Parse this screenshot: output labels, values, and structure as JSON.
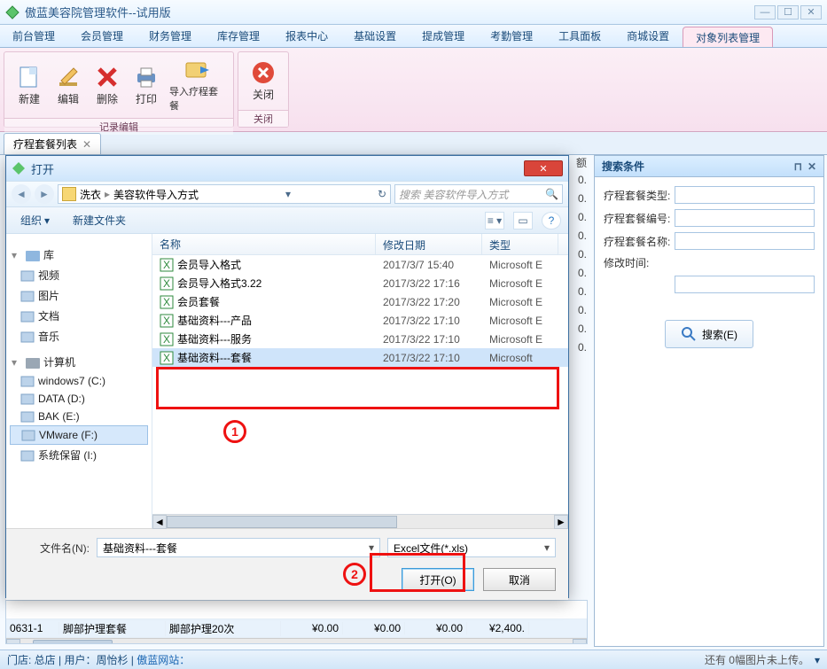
{
  "app": {
    "title": "傲蓝美容院管理软件--试用版"
  },
  "menu": {
    "items": [
      "前台管理",
      "会员管理",
      "财务管理",
      "库存管理",
      "报表中心",
      "基础设置",
      "提成管理",
      "考勤管理",
      "工具面板",
      "商城设置",
      "对象列表管理"
    ],
    "active_index": 10
  },
  "ribbon": {
    "group1_label": "记录编辑",
    "btn_new": "新建",
    "btn_edit": "编辑",
    "btn_delete": "删除",
    "btn_print": "打印",
    "btn_import": "导入疗程套餐",
    "group2_label": "关闭",
    "btn_close": "关闭"
  },
  "doc_tab": {
    "label": "疗程套餐列表"
  },
  "search_panel": {
    "title": "搜索条件",
    "field_type": "疗程套餐类型:",
    "field_code": "疗程套餐编号:",
    "field_name": "疗程套餐名称:",
    "field_modtime": "修改时间:",
    "button": "搜索(E)"
  },
  "grid": {
    "rows": [
      {
        "c0": "0631-1",
        "c1": "脚部护理套餐",
        "c2": "脚部护理20次",
        "c3": "¥0.00",
        "c4": "¥0.00",
        "c5": "¥0.00",
        "c6": "¥2,400."
      }
    ],
    "cut_values": [
      "额",
      "0.",
      "0.",
      "0.",
      "0.",
      "0.",
      "0.",
      "0.",
      "0.",
      "0.",
      "0."
    ]
  },
  "file_dialog": {
    "title": "打开",
    "crumb_seg1": "洗衣",
    "crumb_seg2": "美容软件导入方式",
    "search_placeholder": "搜索 美容软件导入方式",
    "btn_organize": "组织",
    "btn_newfolder": "新建文件夹",
    "tree": {
      "lib_header": "库",
      "lib_items": [
        "视频",
        "图片",
        "文档",
        "音乐"
      ],
      "comp_header": "计算机",
      "comp_items": [
        "windows7 (C:)",
        "DATA (D:)",
        "BAK (E:)",
        "VMware (F:)",
        "系统保留 (I:)"
      ],
      "comp_selected_index": 3
    },
    "list": {
      "col_name": "名称",
      "col_date": "修改日期",
      "col_type": "类型",
      "files": [
        {
          "name": "会员导入格式",
          "date": "2017/3/7 15:40",
          "type": "Microsoft E"
        },
        {
          "name": "会员导入格式3.22",
          "date": "2017/3/22 17:16",
          "type": "Microsoft E"
        },
        {
          "name": "会员套餐",
          "date": "2017/3/22 17:20",
          "type": "Microsoft E"
        },
        {
          "name": "基础资料---产品",
          "date": "2017/3/22 17:10",
          "type": "Microsoft E"
        },
        {
          "name": "基础资料---服务",
          "date": "2017/3/22 17:10",
          "type": "Microsoft E"
        },
        {
          "name": "基础资料---套餐",
          "date": "2017/3/22 17:10",
          "type": "Microsoft"
        }
      ],
      "selected_index": 5
    },
    "filename_label": "文件名(N):",
    "filename_value": "基础资料---套餐",
    "filter_value": "Excel文件(*.xls)",
    "btn_open": "打开(O)",
    "btn_cancel": "取消"
  },
  "markers": {
    "m1": "1",
    "m2": "2"
  },
  "status": {
    "left_store": "门店: 总店 |",
    "left_user": "用户：周怡杉 |",
    "left_link": "傲蓝网站：",
    "right": "还有 0幅图片未上传。"
  }
}
